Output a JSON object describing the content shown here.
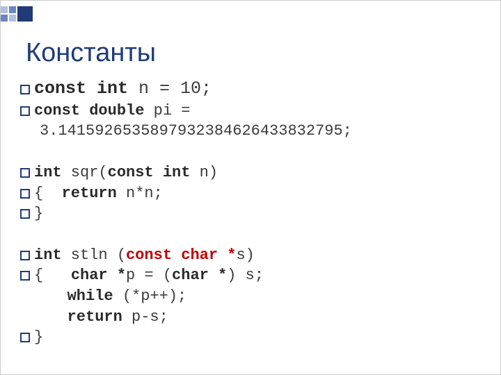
{
  "title": "Константы",
  "code": {
    "l1_const_int": "const int",
    "l1_rest": " n = 10;",
    "l2_const_double": "const double",
    "l2_rest": " pi =",
    "l3_val": "3.1415926535897932384626433832795;",
    "l5_int": "int",
    "l5_sqr": " sqr(",
    "l5_constint": "const int",
    "l5_rest": " n)",
    "l6_open": "{",
    "l6_return": "return",
    "l6_rest": " n*n;",
    "l7_close": "}",
    "l9_int": "int",
    "l9_name": " stln (",
    "l9_constchar": "const char *",
    "l9_s": "s)",
    "l10_open": "{",
    "l10_char": "char *",
    "l10_mid": "p = (",
    "l10_char2": "char *",
    "l10_end": ") s;",
    "l11_while": "while",
    "l11_rest": " (*p++);",
    "l12_return": "return",
    "l12_rest": " p-s;",
    "l13_close": "}"
  }
}
